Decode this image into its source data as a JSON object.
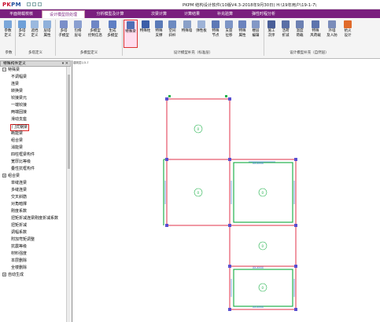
{
  "app": {
    "logo": "PKPM",
    "title": "PKPM 结构设计软件(10版V4.3-2018年9月30日) H:\\19年用户\\19-1-7\\"
  },
  "menu_tabs": [
    {
      "label": "平面荷载校核"
    },
    {
      "label": "设计模型前处理"
    },
    {
      "label": "分析模型及计算"
    },
    {
      "label": "次梁计算"
    },
    {
      "label": "计算结果"
    },
    {
      "label": "补充验算"
    },
    {
      "label": "弹性时程分析"
    }
  ],
  "ribbon": {
    "buttons": [
      {
        "label": "参数\n定义",
        "icon": "params-icon"
      },
      {
        "label": "多塔\n定义",
        "icon": "multi-tower-icon"
      },
      {
        "label": "遮挡\n定义",
        "icon": "shelter-icon"
      },
      {
        "label": "层塔\n属性",
        "icon": "floor-attr-icon"
      },
      {
        "label": "多塔\n子模型",
        "icon": "submodel-icon"
      },
      {
        "label": "包络\n层号",
        "icon": "envelope-icon"
      },
      {
        "label": "多模型\n控制信息",
        "icon": "model-control-icon"
      },
      {
        "label": "生成\n多模型",
        "icon": "generate-icon"
      },
      {
        "label": "特殊梁",
        "icon": "special-beam-icon"
      },
      {
        "label": "特殊柱",
        "icon": "special-column-icon"
      },
      {
        "label": "特殊\n支撑",
        "icon": "special-brace-icon"
      },
      {
        "label": "空间\n斜杆",
        "icon": "space-strut-icon"
      },
      {
        "label": "特殊墙",
        "icon": "special-wall-icon"
      },
      {
        "label": "弹性板",
        "icon": "elastic-slab-icon"
      },
      {
        "label": "特殊\n节点",
        "icon": "special-node-icon"
      },
      {
        "label": "支座\n位移",
        "icon": "support-icon"
      },
      {
        "label": "特殊\n属性",
        "icon": "special-attr-icon"
      },
      {
        "label": "楼层\n编辑",
        "icon": "floor-edit-icon"
      },
      {
        "label": "施工\n次序",
        "icon": "construction-icon"
      },
      {
        "label": "活荷\n折减",
        "icon": "live-load-icon"
      },
      {
        "label": "温度\n荷载",
        "icon": "temperature-icon"
      },
      {
        "label": "特殊\n风荷载",
        "icon": "wind-icon"
      },
      {
        "label": "外墙\n及人防",
        "icon": "outer-wall-icon"
      },
      {
        "label": "抗火\n设计",
        "icon": "fire-icon"
      }
    ],
    "groups": [
      {
        "label": "参数"
      },
      {
        "label": "多塔定义"
      },
      {
        "label": "多模型定义"
      },
      {
        "label": "设计模型补充（标准层）"
      },
      {
        "label": "设计模型补充（自然层）"
      }
    ]
  },
  "panel": {
    "title": "特殊构件定义",
    "close": "▾ ✕",
    "items": [
      {
        "label": "特殊梁",
        "level": 0,
        "toggle": "−"
      },
      {
        "label": "不调幅梁",
        "level": 1
      },
      {
        "label": "连梁",
        "level": 1
      },
      {
        "label": "转换梁",
        "level": 1
      },
      {
        "label": "铰接梁元",
        "level": 1
      },
      {
        "label": "一端铰接",
        "level": 1
      },
      {
        "label": "两端固接",
        "level": 1
      },
      {
        "label": "滑动支座",
        "level": 1
      },
      {
        "label": "门式钢梁",
        "level": 1,
        "highlighted": true
      },
      {
        "label": "耗能梁",
        "level": 1
      },
      {
        "label": "组合梁",
        "level": 1
      },
      {
        "label": "消能梁",
        "level": 1
      },
      {
        "label": "四柱框梁构件",
        "level": 1
      },
      {
        "label": "宽厚比等级",
        "level": 1
      },
      {
        "label": "叠性抗框构件",
        "level": 1
      },
      {
        "label": "组合梁",
        "level": 0,
        "toggle": "+"
      },
      {
        "label": "单缝连梁",
        "level": 1
      },
      {
        "label": "多缝连梁",
        "level": 1
      },
      {
        "label": "交叉斜筋",
        "level": 1
      },
      {
        "label": "对角暗撑",
        "level": 1
      },
      {
        "label": "刚度系数",
        "level": 1
      },
      {
        "label": "扭矩折减连梁刚度折减系数",
        "level": 1
      },
      {
        "label": "扭矩折减",
        "level": 1
      },
      {
        "label": "调幅系数",
        "level": 1
      },
      {
        "label": "附加弯矩调整",
        "level": 1
      },
      {
        "label": "抗震等级",
        "level": 1
      },
      {
        "label": "材料强度",
        "level": 1
      },
      {
        "label": "本层删除",
        "level": 1
      },
      {
        "label": "全楼删除",
        "level": 1
      },
      {
        "label": "自动生成",
        "level": 0,
        "toggle": "+"
      }
    ]
  },
  "canvas": {
    "view_label": "建筑层1/3-7",
    "room_marker": "0",
    "span_labels": [
      "XX-XXXX",
      "XX-XXXX",
      "XX-XXXX"
    ],
    "colors": {
      "beam": "#e0304a",
      "highlight": "#22b24c",
      "node": "#5a4fd0",
      "dim": "#2c6fd0"
    }
  }
}
